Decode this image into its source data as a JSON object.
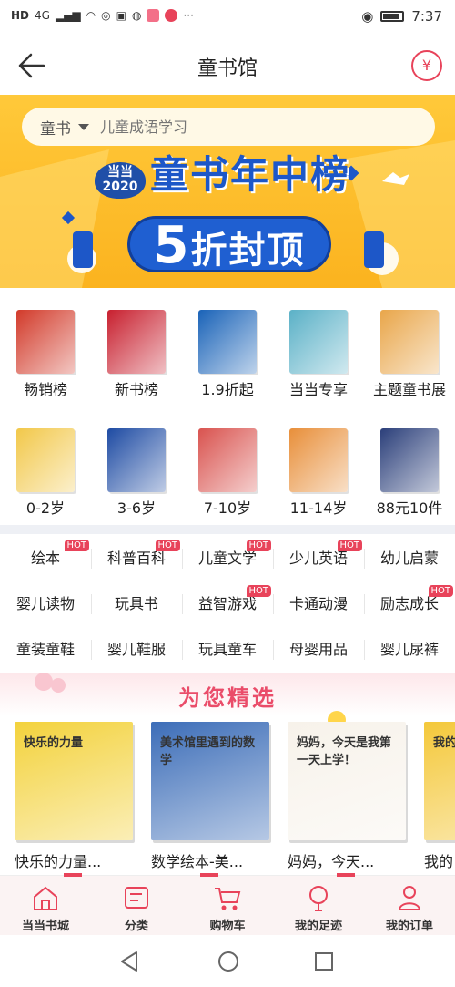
{
  "status_bar": {
    "network": "HD",
    "signal": "4G",
    "time": "7:37",
    "more": "···"
  },
  "header": {
    "title": "童书馆"
  },
  "search": {
    "category": "童书",
    "placeholder": "儿童成语学习"
  },
  "banner": {
    "brand": "当当",
    "year": "2020",
    "headline": "童书年中榜",
    "promo_number": "5",
    "promo_text": "折封顶"
  },
  "quick_entries": [
    {
      "label": "畅销榜",
      "color": "#d23a2a"
    },
    {
      "label": "新书榜",
      "color": "#c8202f"
    },
    {
      "label": "1.9折起",
      "color": "#1a63b8"
    },
    {
      "label": "当当专享",
      "color": "#5bb1c7"
    },
    {
      "label": "主题童书展",
      "color": "#e9a64a"
    }
  ],
  "age_entries": [
    {
      "label": "0-2岁",
      "color": "#f2c84a"
    },
    {
      "label": "3-6岁",
      "color": "#1e4ba3"
    },
    {
      "label": "7-10岁",
      "color": "#d9534f"
    },
    {
      "label": "11-14岁",
      "color": "#e88f3a"
    },
    {
      "label": "88元10件",
      "color": "#2b3f7a"
    }
  ],
  "categories": [
    [
      {
        "label": "绘本",
        "hot": "HOT"
      },
      {
        "label": "科普百科",
        "hot": "HOT"
      },
      {
        "label": "儿童文学",
        "hot": "HOT"
      },
      {
        "label": "少儿英语",
        "hot": "HOT"
      },
      {
        "label": "幼儿启蒙",
        "hot": ""
      }
    ],
    [
      {
        "label": "婴儿读物",
        "hot": ""
      },
      {
        "label": "玩具书",
        "hot": ""
      },
      {
        "label": "益智游戏",
        "hot": "HOT"
      },
      {
        "label": "卡通动漫",
        "hot": ""
      },
      {
        "label": "励志成长",
        "hot": "HOT"
      }
    ],
    [
      {
        "label": "童装童鞋",
        "hot": ""
      },
      {
        "label": "婴儿鞋服",
        "hot": ""
      },
      {
        "label": "玩具童车",
        "hot": ""
      },
      {
        "label": "母婴用品",
        "hot": ""
      },
      {
        "label": "婴儿尿裤",
        "hot": ""
      }
    ]
  ],
  "recommend": {
    "title": "为您精选",
    "books": [
      {
        "name": "快乐的力量...",
        "cover_text": "快乐的力量",
        "color": "#f3d23c"
      },
      {
        "name": "数学绘本-美...",
        "cover_text": "美术馆里遇到的数学",
        "color": "#3c6db8"
      },
      {
        "name": "妈妈，今天...",
        "cover_text": "妈妈，今天是我第一天上学！",
        "color": "#f7f2ea"
      },
      {
        "name": "我的",
        "cover_text": "我的",
        "color": "#f4c83a"
      }
    ]
  },
  "tabbar": [
    {
      "label": "当当书城",
      "icon": "home-icon"
    },
    {
      "label": "分类",
      "icon": "category-icon"
    },
    {
      "label": "购物车",
      "icon": "cart-icon"
    },
    {
      "label": "我的足迹",
      "icon": "footprint-icon"
    },
    {
      "label": "我的订单",
      "icon": "order-icon"
    }
  ],
  "theme": {
    "accent": "#e8435a",
    "banner": "#fbb31f",
    "brand_blue": "#1f5fd1"
  }
}
